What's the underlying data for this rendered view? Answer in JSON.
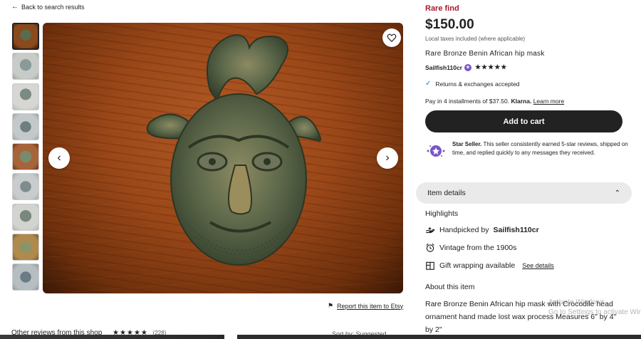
{
  "nav": {
    "back_label": "Back to search results"
  },
  "gallery": {
    "thumbnail_count": 9,
    "selected_index": 0,
    "favorite_icon": "heart-icon",
    "prev_icon": "chevron-left-icon",
    "next_icon": "chevron-right-icon"
  },
  "report": {
    "label": "Report this item to Etsy",
    "icon": "flag-icon"
  },
  "listing": {
    "badge": "Rare find",
    "price": "$150.00",
    "taxes_note": "Local taxes included (where applicable)",
    "title": "Rare Bronze Benin African hip mask",
    "seller_name": "Sailfish110cr",
    "seller_rating_stars": 5,
    "returns": "Returns & exchanges accepted",
    "installments_prefix": "Pay in 4 installments of $37.50.",
    "installments_brand": "Klarna.",
    "installments_link": "Learn more",
    "add_to_cart": "Add to cart",
    "star_seller_label": "Star Seller.",
    "star_seller_text": "This seller consistently earned 5-star reviews, shipped on time, and replied quickly to any messages they received."
  },
  "details": {
    "section_label": "Item details",
    "highlights_heading": "Highlights",
    "handpicked_prefix": "Handpicked by",
    "handpicked_by": "Sailfish110cr",
    "vintage": "Vintage from the 1900s",
    "gift_wrap": "Gift wrapping available",
    "gift_wrap_link": "See details",
    "about_heading": "About this item",
    "about_text": "Rare Bronze Benin African hip mask with Crocodile head ornament hand made lost wax process Measures 6\" by 4\" by 2\""
  },
  "bottom": {
    "other_reviews": "Other reviews from this shop",
    "review_count": "(228)",
    "sort_label": "Sort by: Suggested"
  },
  "os_watermark": {
    "line1": "Activate Windows",
    "line2": "Go to Settings to activate Windows."
  },
  "colors": {
    "accent_red": "#a61a2e",
    "button_dark": "#222222",
    "star_seller_purple": "#7b55c7",
    "check_blue": "#2f6fdb"
  }
}
